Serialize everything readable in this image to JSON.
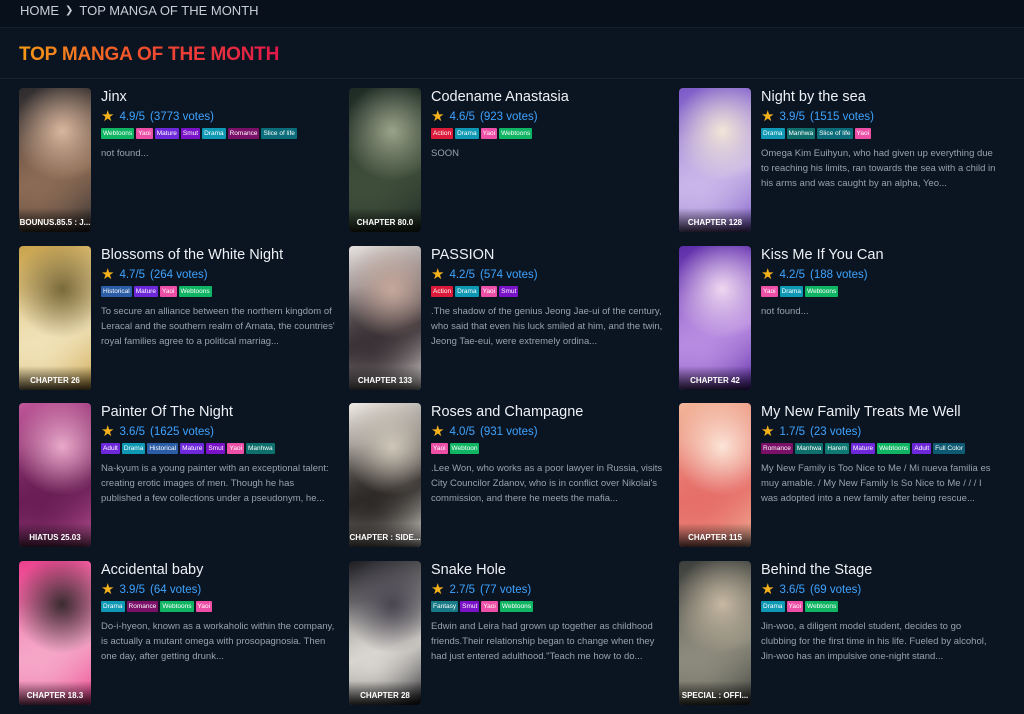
{
  "breadcrumb": {
    "home": "HOME",
    "current": "TOP MANGA OF THE MONTH"
  },
  "section_title": "TOP MANGA OF THE MONTH",
  "tag_colors": {
    "Webtoons": "#10b564",
    "Webtoon": "#10b564",
    "Yaoi": "#ee4fa6",
    "Mature": "#6d28d9",
    "Smut": "#7a12c8",
    "Drama": "#0e98b3",
    "Romance": "#7b1068",
    "Slice of life": "#0b6c7a",
    "Action": "#dc1b3a",
    "Manhwa": "#0f6f6c",
    "Historical": "#2b5da6",
    "Adult": "#6d28d9",
    "Harem": "#0f7a73",
    "Full Color": "#0e5a73",
    "Fantasy": "#177a86"
  },
  "manga": [
    {
      "title": "Jinx",
      "rating": "4.9/5",
      "votes": "(3773 votes)",
      "chapter": "BOUNUS.85.5 : J...",
      "tags": [
        "Webtoons",
        "Yaoi",
        "Mature",
        "Smut",
        "Drama",
        "Romance",
        "Slice of life"
      ],
      "desc": "not found...",
      "cover": [
        "#2b2a2e",
        "#8a6a54",
        "#d9b79e"
      ]
    },
    {
      "title": "Codename Anastasia",
      "rating": "4.6/5",
      "votes": "(923 votes)",
      "chapter": "CHAPTER 80.0",
      "tags": [
        "Action",
        "Drama",
        "Yaoi",
        "Webtoons"
      ],
      "desc": "SOON",
      "cover": [
        "#1d2a24",
        "#3e4d3a",
        "#9aa38a"
      ]
    },
    {
      "title": "Night by the sea",
      "rating": "3.9/5",
      "votes": "(1515 votes)",
      "chapter": "CHAPTER 128",
      "tags": [
        "Drama",
        "Manhwa",
        "Slice of life",
        "Yaoi"
      ],
      "desc": "Omega Kim Euihyun, who had given up everything due to reaching his limits, ran towards the sea with a child in his arms and was caught by an alpha, Yeo...",
      "cover": [
        "#7a58c7",
        "#c9b5e8",
        "#f1e6d7"
      ]
    },
    {
      "title": "Blossoms of the White Night",
      "rating": "4.7/5",
      "votes": "(264 votes)",
      "chapter": "CHAPTER 26",
      "tags": [
        "Historical",
        "Mature",
        "Yaoi",
        "Webtoons"
      ],
      "desc": "To secure an alliance between the northern kingdom of Leracal and the southern realm of Arnata, the countries' royal families agree to a political marriag...",
      "cover": [
        "#c9a24a",
        "#f0e1b6",
        "#7a6a3b"
      ]
    },
    {
      "title": "PASSION",
      "rating": "4.2/5",
      "votes": "(574 votes)",
      "chapter": "CHAPTER 133",
      "tags": [
        "Action",
        "Drama",
        "Yaoi",
        "Smut"
      ],
      "desc": ".The shadow of the genius Jeong Jae-ui of the century, who said that even his luck smiled at him, and the twin, Jeong Tae-eui, were extremely ordina...",
      "cover": [
        "#e8e3e0",
        "#3a3236",
        "#c6a79a"
      ]
    },
    {
      "title": "Kiss Me If You Can",
      "rating": "4.2/5",
      "votes": "(188 votes)",
      "chapter": "CHAPTER 42",
      "tags": [
        "Yaoi",
        "Drama",
        "Webtoons"
      ],
      "desc": "not found...",
      "cover": [
        "#5b2aa8",
        "#b78be0",
        "#efd8f0"
      ]
    },
    {
      "title": "Painter Of The Night",
      "rating": "3.6/5",
      "votes": "(1625 votes)",
      "chapter": "HIATUS 25.03",
      "tags": [
        "Adult",
        "Drama",
        "Historical",
        "Mature",
        "Smut",
        "Yaoi",
        "Manhwa"
      ],
      "desc": "Na-kyum is a young painter with an exceptional talent: creating erotic images of men. Though he has published a few collections under a pseudonym, he...",
      "cover": [
        "#c0579a",
        "#6a1e55",
        "#e8a9c9"
      ]
    },
    {
      "title": "Roses and Champagne",
      "rating": "4.0/5",
      "votes": "(931 votes)",
      "chapter": "CHAPTER : SIDE...",
      "tags": [
        "Yaoi",
        "Webtoon"
      ],
      "desc": ".Lee Won, who works as a poor lawyer in Russia, visits City Councilor Zdanov, who is in conflict over Nikolai's commission, and there he meets the mafia...",
      "cover": [
        "#f1ede6",
        "#2e2a28",
        "#cfc6b8"
      ]
    },
    {
      "title": "My New Family Treats Me Well",
      "rating": "1.7/5",
      "votes": "(23 votes)",
      "chapter": "CHAPTER 115",
      "tags": [
        "Romance",
        "Manhwa",
        "Harem",
        "Mature",
        "Webtoons",
        "Adult",
        "Full Color"
      ],
      "desc": "My New Family is Too Nice to Me / Mi nueva familia es muy amable. / My New Family Is So Nice to Me / / / I was adopted into a new family after being rescue...",
      "cover": [
        "#f2b79b",
        "#e66f6a",
        "#fbe4d6"
      ]
    },
    {
      "title": "Accidental baby",
      "rating": "3.9/5",
      "votes": "(64 votes)",
      "chapter": "CHAPTER 18.3",
      "tags": [
        "Drama",
        "Romance",
        "Webtoons",
        "Yaoi"
      ],
      "desc": "Do-i-hyeon, known as a workaholic within the company, is actually a mutant omega with prosopagnosia. Then one day, after getting drunk...",
      "cover": [
        "#ec3f8c",
        "#f5a6c7",
        "#3a2b30"
      ]
    },
    {
      "title": "Snake Hole",
      "rating": "2.7/5",
      "votes": "(77 votes)",
      "chapter": "CHAPTER 28",
      "tags": [
        "Fantasy",
        "Smut",
        "Yaoi",
        "Webtoons"
      ],
      "desc": "Edwin and Leira had grown up together as childhood friends.Their relationship began to change when they had just entered adulthood.\"Teach me how to do...",
      "cover": [
        "#1c1c22",
        "#d8d5cf",
        "#4a4652"
      ]
    },
    {
      "title": "Behind the Stage",
      "rating": "3.6/5",
      "votes": "(69 votes)",
      "chapter": "SPECIAL : OFFI...",
      "tags": [
        "Drama",
        "Yaoi",
        "Webtoons"
      ],
      "desc": "Jin-woo, a diligent model student, decides to go clubbing for the first time in his life. Fueled by alcohol, Jin-woo has an impulsive one-night stand...",
      "cover": [
        "#3a3d3a",
        "#8c8a7c",
        "#c7b8a2"
      ]
    }
  ]
}
